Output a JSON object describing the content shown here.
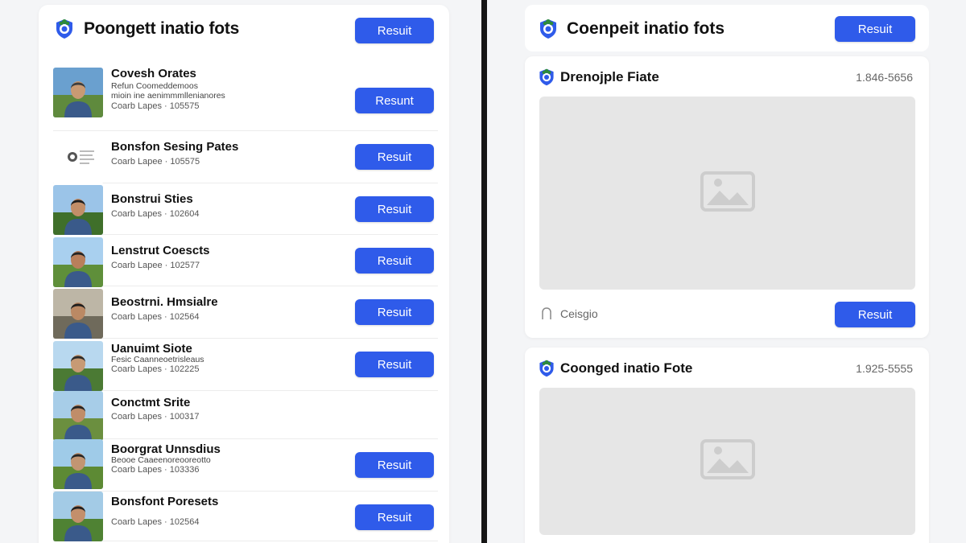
{
  "left": {
    "title": "Poongett inatio fots",
    "header_button": "Resuit",
    "rows": [
      {
        "title": "Covesh Orates",
        "sub1": "Refun Coomeddemoos",
        "sub2": "mioin ine aenimmmllenianores",
        "meta": "Coarb Lapes · 105575",
        "button": "Resunt",
        "thumb": "photo"
      },
      {
        "title": "Bonsfon Sesing Pates",
        "sub1": "",
        "sub2": "",
        "meta": "Coarb Lapee · 105575",
        "button": "Resuit",
        "thumb": "document"
      },
      {
        "title": "Bonstrui Sties",
        "sub1": "",
        "sub2": "",
        "meta": "Coarb Lapes · 102604",
        "button": "Resuit",
        "thumb": "photo"
      },
      {
        "title": "Lenstrut Coescts",
        "sub1": "",
        "sub2": "",
        "meta": "Coarb Lapee · 102577",
        "button": "Resuit",
        "thumb": "photo"
      },
      {
        "title": "Beostrni. Hmsialre",
        "sub1": "",
        "sub2": "",
        "meta": "Coarb Lapes · 102564",
        "button": "Resuit",
        "thumb": "photo"
      },
      {
        "title": "Uanuimt Siote",
        "sub1": "Fesic Caanneoetrisleaus",
        "sub2": "",
        "meta": "Coarb Lapes · 102225",
        "button": "Resuit",
        "thumb": "photo"
      },
      {
        "title": "Conctmt Srite",
        "sub1": "",
        "sub2": "",
        "meta": "Coarb Lapes · 100317",
        "button": "",
        "thumb": "photo"
      },
      {
        "title": "Boorgrat Unnsdius",
        "sub1": "Beooe Caaeenoreooreotto",
        "sub2": "",
        "meta": "Coarb Lapes · 103336",
        "button": "Resuit",
        "thumb": "photo"
      },
      {
        "title": "Bonsfont Poresets",
        "sub1": "",
        "sub2": "",
        "meta": "Coarb Lapes · 102564",
        "button": "Resuit",
        "thumb": "photo"
      }
    ]
  },
  "right": {
    "title": "Coenpeit inatio fots",
    "header_button": "Resuit",
    "cards": [
      {
        "title": "Drenojple Fiate",
        "number": "1.846-5656",
        "footer_label": "Ceisgio",
        "button": "Resuit"
      },
      {
        "title": "Coonged inatio Fote",
        "number": "1.925-5555"
      }
    ]
  },
  "colors": {
    "accent": "#2f5bea",
    "background": "#f4f5f7",
    "panel": "#ffffff",
    "placeholder": "#e6e6e6"
  },
  "icons": {
    "logo": "shield-logo-icon",
    "placeholder": "image-placeholder-icon",
    "footer": "tag-icon"
  }
}
